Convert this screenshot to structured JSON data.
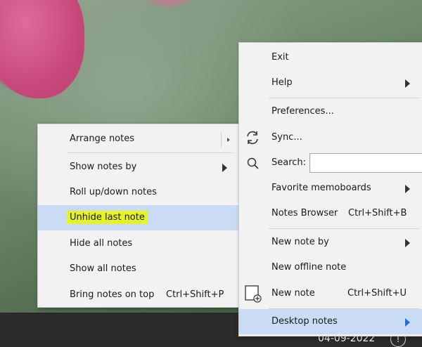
{
  "taskbar": {
    "date": "04-09-2022",
    "info": "!"
  },
  "left_menu": {
    "items": [
      {
        "label": "Arrange notes"
      },
      {
        "label": "Show notes by"
      },
      {
        "label": "Roll up/down notes"
      },
      {
        "label": "Unhide last note"
      },
      {
        "label": "Hide all notes"
      },
      {
        "label": "Show all notes"
      },
      {
        "label": "Bring notes on top",
        "shortcut": "Ctrl+Shift+P"
      }
    ]
  },
  "right_menu": {
    "items": [
      {
        "label": "Exit"
      },
      {
        "label": "Help"
      },
      {
        "label": "Preferences..."
      },
      {
        "label": "Sync..."
      },
      {
        "label": "Search:"
      },
      {
        "label": "Favorite memoboards"
      },
      {
        "label": "Notes Browser",
        "shortcut": "Ctrl+Shift+B"
      },
      {
        "label": "New note by"
      },
      {
        "label": "New offline note"
      },
      {
        "label": "New note",
        "shortcut": "Ctrl+Shift+U"
      },
      {
        "label": "Desktop notes"
      }
    ],
    "search_value": ""
  },
  "colors": {
    "highlight": "#c9dcf3",
    "marker": "#e5f227",
    "accent_arrow": "#1e6fd9"
  }
}
